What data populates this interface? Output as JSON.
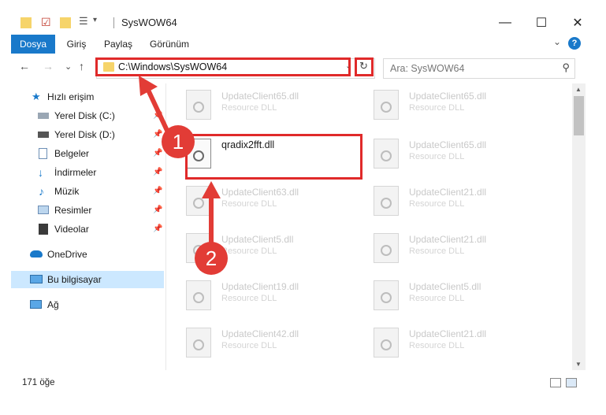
{
  "window": {
    "title": "SysWOW64",
    "controls": {
      "minimize": "—",
      "maximize": "☐",
      "close": "✕"
    }
  },
  "ribbon": {
    "tabs": [
      "Dosya",
      "Giriş",
      "Paylaş",
      "Görünüm"
    ],
    "active_tab": "Dosya",
    "help": "?"
  },
  "navigation": {
    "back": "←",
    "forward": "→",
    "recent": "⌄",
    "up": "↑",
    "address": "C:\\Windows\\SysWOW64",
    "search_placeholder": "Ara: SysWOW64"
  },
  "sidebar": {
    "items": [
      {
        "label": "Hızlı erişim",
        "icon": "star-icon",
        "pinned": false
      },
      {
        "label": "Yerel Disk (C:)",
        "icon": "drive-icon",
        "pinned": true
      },
      {
        "label": "Yerel Disk (D:)",
        "icon": "drive-icon",
        "pinned": true
      },
      {
        "label": "Belgeler",
        "icon": "documents-icon",
        "pinned": true
      },
      {
        "label": "İndirmeler",
        "icon": "download-icon",
        "pinned": true
      },
      {
        "label": "Müzik",
        "icon": "music-icon",
        "pinned": true
      },
      {
        "label": "Resimler",
        "icon": "pictures-icon",
        "pinned": true
      },
      {
        "label": "Videolar",
        "icon": "videos-icon",
        "pinned": true
      },
      {
        "label": "OneDrive",
        "icon": "cloud-icon",
        "pinned": false
      },
      {
        "label": "Bu bilgisayar",
        "icon": "computer-icon",
        "pinned": false,
        "selected": true
      },
      {
        "label": "Ağ",
        "icon": "network-icon",
        "pinned": false
      }
    ]
  },
  "files": {
    "left_column": [
      {
        "name": "UpdateClient65.dll",
        "type": "Resource DLL"
      },
      {
        "name": "qradix2fft.dll",
        "type": ""
      },
      {
        "name": "UpdateClient63.dll",
        "type": "Resource DLL"
      },
      {
        "name": "UpdateClient5.dll",
        "type": "Resource DLL"
      },
      {
        "name": "UpdateClient19.dll",
        "type": "Resource DLL"
      },
      {
        "name": "UpdateClient42.dll",
        "type": "Resource DLL"
      }
    ],
    "right_column": [
      {
        "name": "UpdateClient65.dll",
        "type": "Resource DLL"
      },
      {
        "name": "UpdateClient65.dll",
        "type": "Resource DLL"
      },
      {
        "name": "UpdateClient21.dll",
        "type": "Resource DLL"
      },
      {
        "name": "UpdateClient21.dll",
        "type": "Resource DLL"
      },
      {
        "name": "UpdateClient5.dll",
        "type": "Resource DLL"
      },
      {
        "name": "UpdateClient21.dll",
        "type": "Resource DLL"
      }
    ]
  },
  "status": {
    "count": "171 öğe"
  },
  "annotations": {
    "step1": "1",
    "step2": "2",
    "color": "#e23c36"
  }
}
